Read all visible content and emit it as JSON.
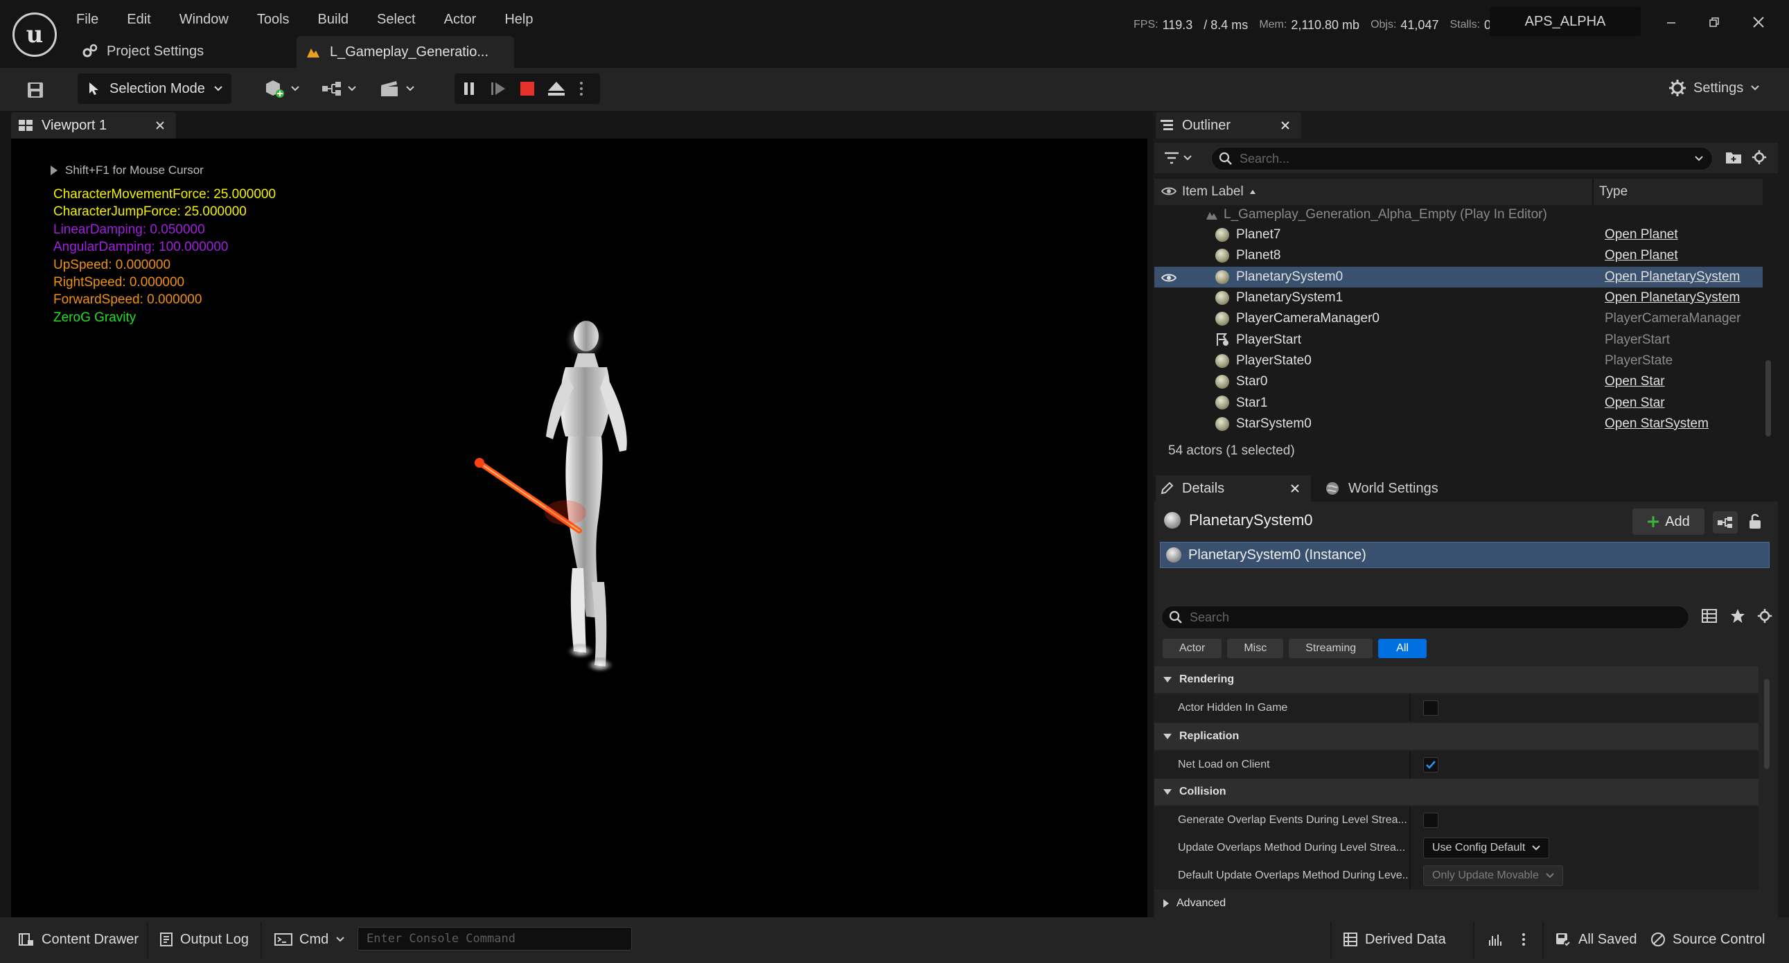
{
  "app": {
    "logo_text": "u",
    "menu": [
      "File",
      "Edit",
      "Window",
      "Tools",
      "Build",
      "Select",
      "Actor",
      "Help"
    ],
    "project_settings_label": "Project Settings",
    "level_tab_label": "L_Gameplay_Generatio...",
    "stats": {
      "fps_label": "FPS:",
      "fps_value": "119.3",
      "ms_value": "/ 8.4 ms",
      "mem_label": "Mem:",
      "mem_value": "2,110.80 mb",
      "objs_label": "Objs:",
      "objs_value": "41,047",
      "stalls_label": "Stalls:",
      "stalls_value": "0"
    },
    "build_badge": "APS_ALPHA"
  },
  "toolbar": {
    "mode_label": "Selection Mode",
    "settings_label": "Settings"
  },
  "viewport": {
    "tab_label": "Viewport 1",
    "hint": "Shift+F1 for Mouse Cursor",
    "debug": [
      {
        "text": "CharacterMovementForce: 25.000000",
        "color": "#f4f000"
      },
      {
        "text": "CharacterJumpForce: 25.000000",
        "color": "#f4f000"
      },
      {
        "text": "LinearDamping: 0.050000",
        "color": "#a020e0"
      },
      {
        "text": "AngularDamping: 100.000000",
        "color": "#a020e0"
      },
      {
        "text": "UpSpeed: 0.000000",
        "color": "#f09010"
      },
      {
        "text": "RightSpeed: 0.000000",
        "color": "#f09010"
      },
      {
        "text": "ForwardSpeed: 0.000000",
        "color": "#f09010"
      },
      {
        "text": "ZeroG Gravity",
        "color": "#20e020"
      }
    ]
  },
  "outliner": {
    "tab_label": "Outliner",
    "search_placeholder": "Search...",
    "col_label": "Item Label",
    "col_type": "Type",
    "root_label": "L_Gameplay_Generation_Alpha_Empty (Play In Editor)",
    "rows": [
      {
        "label": "Planet7",
        "type": "Open Planet",
        "link": true
      },
      {
        "label": "Planet8",
        "type": "Open Planet",
        "link": true
      },
      {
        "label": "PlanetarySystem0",
        "type": "Open PlanetarySystem",
        "link": true,
        "selected": true
      },
      {
        "label": "PlanetarySystem1",
        "type": "Open PlanetarySystem",
        "link": true
      },
      {
        "label": "PlayerCameraManager0",
        "type": "PlayerCameraManager",
        "link": false
      },
      {
        "label": "PlayerStart",
        "type": "PlayerStart",
        "link": false,
        "icon": "flag"
      },
      {
        "label": "PlayerState0",
        "type": "PlayerState",
        "link": false
      },
      {
        "label": "Star0",
        "type": "Open Star",
        "link": true
      },
      {
        "label": "Star1",
        "type": "Open Star",
        "link": true
      },
      {
        "label": "StarSystem0",
        "type": "Open StarSystem",
        "link": true
      }
    ],
    "footer": "54 actors (1 selected)"
  },
  "details": {
    "tab_label": "Details",
    "world_settings_label": "World Settings",
    "actor_name": "PlanetarySystem0",
    "add_label": "Add",
    "instance_label": "PlanetarySystem0 (Instance)",
    "search_placeholder": "Search",
    "filters": [
      "Actor",
      "Misc",
      "Streaming",
      "All"
    ],
    "active_filter": "All",
    "categories": {
      "rendering": "Rendering",
      "replication": "Replication",
      "collision": "Collision",
      "advanced": "Advanced"
    },
    "props": {
      "hidden_in_game": {
        "name": "Actor Hidden In Game",
        "checked": false
      },
      "net_load": {
        "name": "Net Load on Client",
        "checked": true
      },
      "gen_overlap": {
        "name": "Generate Overlap Events During Level Strea...",
        "checked": false
      },
      "update_overlaps": {
        "name": "Update Overlaps Method During Level Strea...",
        "value": "Use Config Default"
      },
      "default_update": {
        "name": "Default Update Overlaps Method During Leve...",
        "value": "Only Update Movable"
      }
    }
  },
  "statusbar": {
    "content_drawer": "Content Drawer",
    "output_log": "Output Log",
    "cmd": "Cmd",
    "console_placeholder": "Enter Console Command",
    "derived_data": "Derived Data",
    "all_saved": "All Saved",
    "source_control": "Source Control"
  },
  "colors": {
    "accent": "#0070e0",
    "selection": "#39506e",
    "background": "#151515",
    "panel": "#242424"
  }
}
